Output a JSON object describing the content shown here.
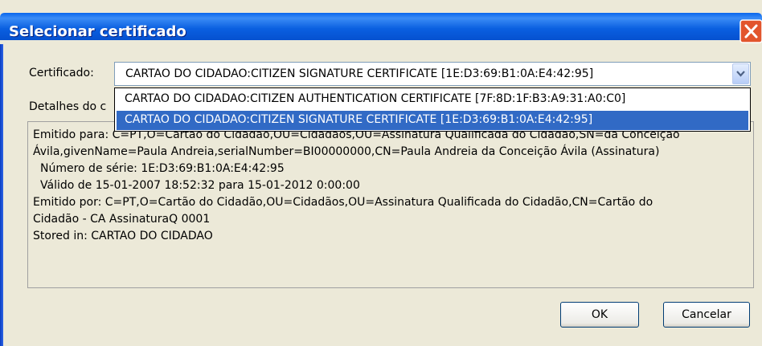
{
  "window": {
    "title": "Selecionar certificado"
  },
  "form": {
    "certificate_label": "Certificado:",
    "details_label": "Detalhes do c",
    "selected_value": "CARTAO DO CIDADAO:CITIZEN SIGNATURE CERTIFICATE [1E:D3:69:B1:0A:E4:42:95]",
    "options": [
      "CARTAO DO CIDADAO:CITIZEN AUTHENTICATION CERTIFICATE [7F:8D:1F:B3:A9:31:A0:C0]",
      "CARTAO DO CIDADAO:CITIZEN SIGNATURE CERTIFICATE [1E:D3:69:B1:0A:E4:42:95]"
    ]
  },
  "details": {
    "lines": [
      "Emitido para: C=PT,O=Cartão do Cidadão,OU=Cidadãos,OU=Assinatura Qualificada do Cidadão,SN=da Conceição",
      "Ávila,givenName=Paula Andreia,serialNumber=BI00000000,CN=Paula Andreia da Conceição Ávila (Assinatura)",
      "Número de série: 1E:D3:69:B1:0A:E4:42:95",
      "Válido de 15-01-2007 18:52:32 para 15-01-2012 0:00:00",
      "Emitido por: C=PT,O=Cartão do Cidadão,OU=Cidadãos,OU=Assinatura Qualificada do Cidadão,CN=Cartão do",
      "Cidadão - CA AssinaturaQ 0001",
      "Stored in: CARTAO DO CIDADAO"
    ]
  },
  "buttons": {
    "ok": "OK",
    "cancel": "Cancelar"
  },
  "colors": {
    "titlebar": "#0a3ec2",
    "selection": "#316ac5",
    "close": "#e2552d"
  },
  "icons": {
    "close": "close-icon",
    "dropdown": "chevron-down-icon"
  }
}
